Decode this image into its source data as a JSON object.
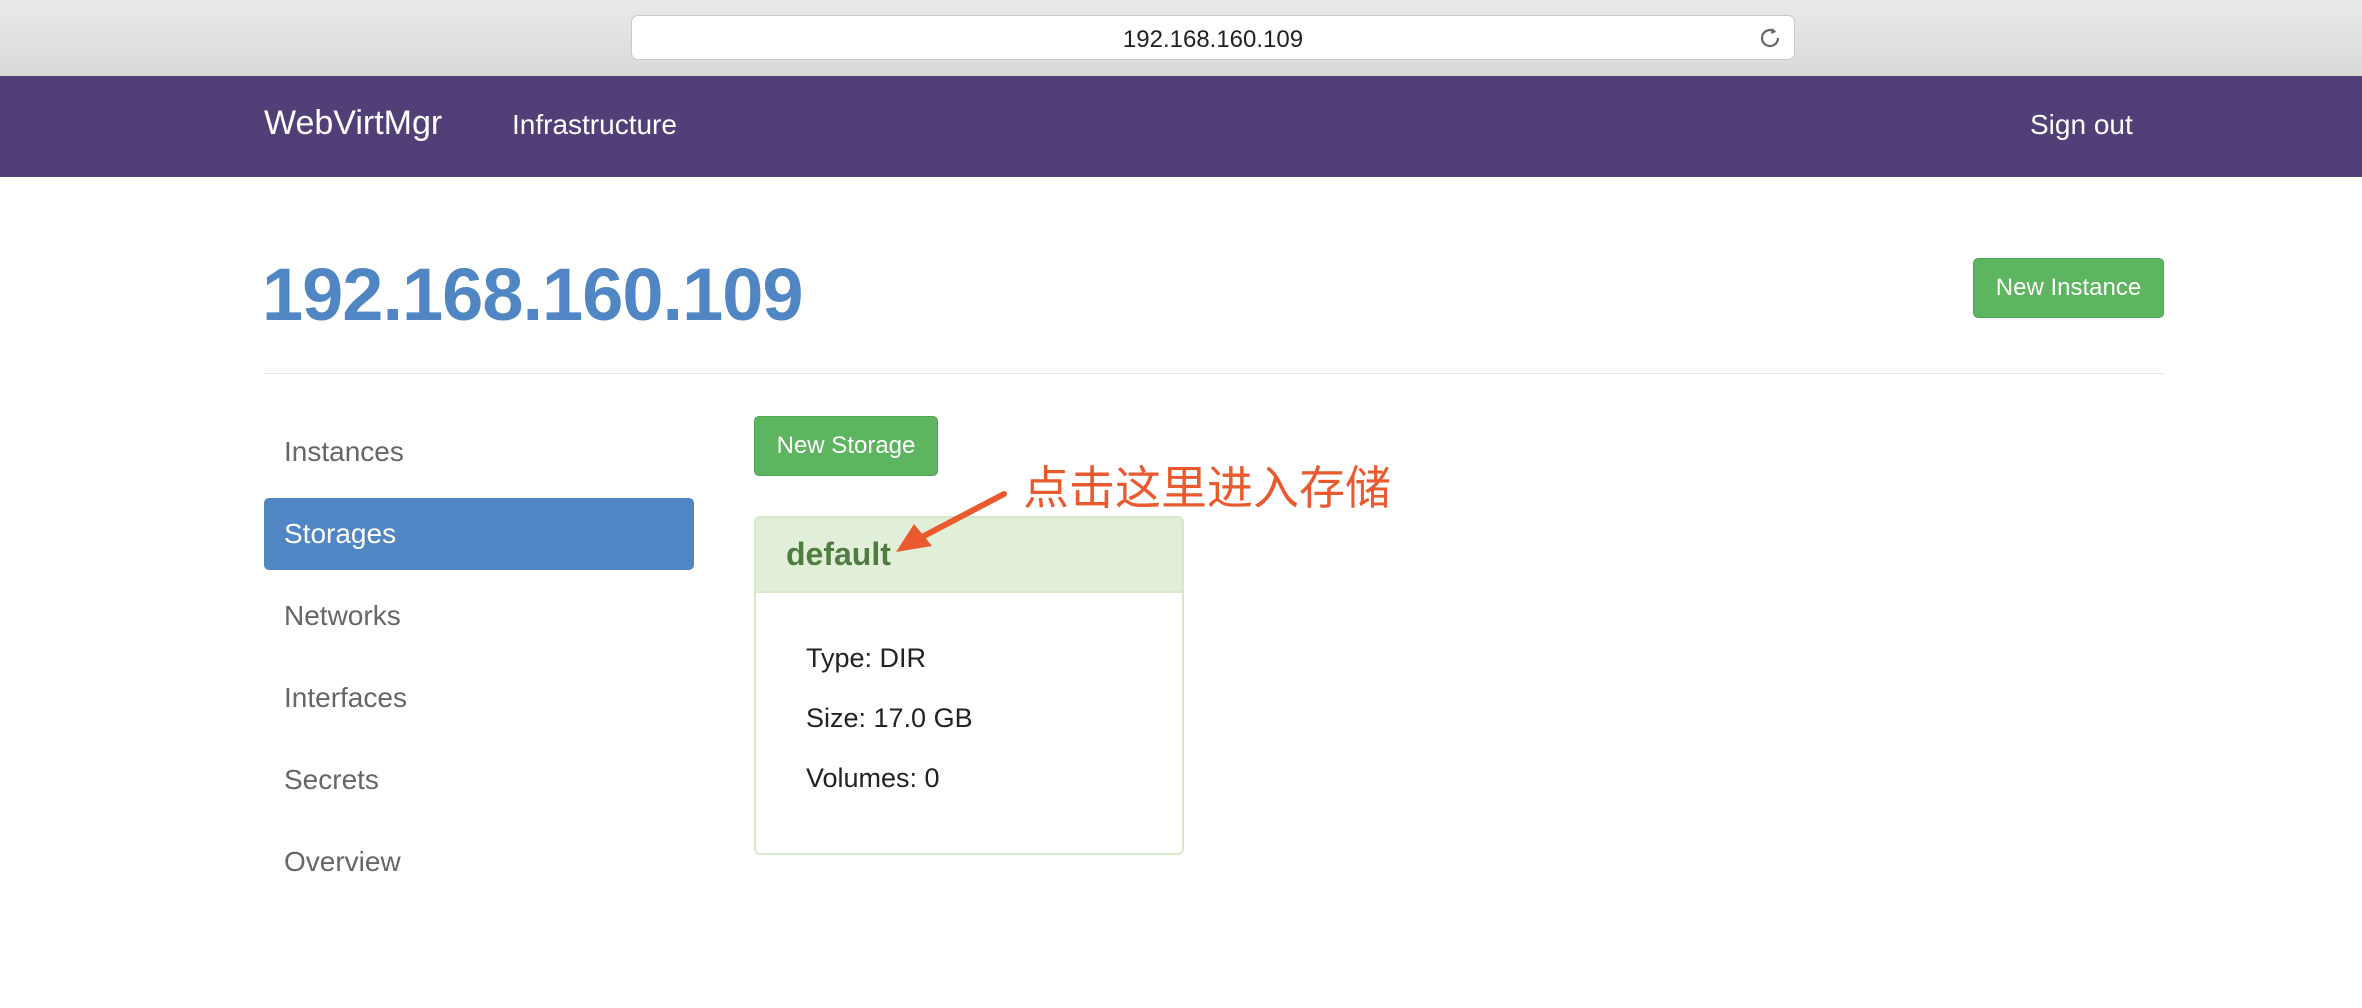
{
  "browser": {
    "url": "192.168.160.109"
  },
  "navbar": {
    "brand": "WebVirtMgr",
    "infrastructure": "Infrastructure",
    "sign_out": "Sign out"
  },
  "page": {
    "title": "192.168.160.109",
    "new_instance": "New Instance"
  },
  "sidebar": {
    "items": [
      {
        "label": "Instances"
      },
      {
        "label": "Storages",
        "active": true
      },
      {
        "label": "Networks"
      },
      {
        "label": "Interfaces"
      },
      {
        "label": "Secrets"
      },
      {
        "label": "Overview"
      }
    ]
  },
  "content": {
    "new_storage": "New Storage",
    "pool": {
      "name": "default",
      "type_label": "Type: DIR",
      "size_label": "Size: 17.0 GB",
      "volumes_label": "Volumes: 0"
    }
  },
  "annotation": {
    "text": "点击这里进入存储",
    "color": "#ea5a2e"
  },
  "colors": {
    "navbar": "#533f78",
    "accent": "#4f86c3",
    "success": "#5db560"
  }
}
